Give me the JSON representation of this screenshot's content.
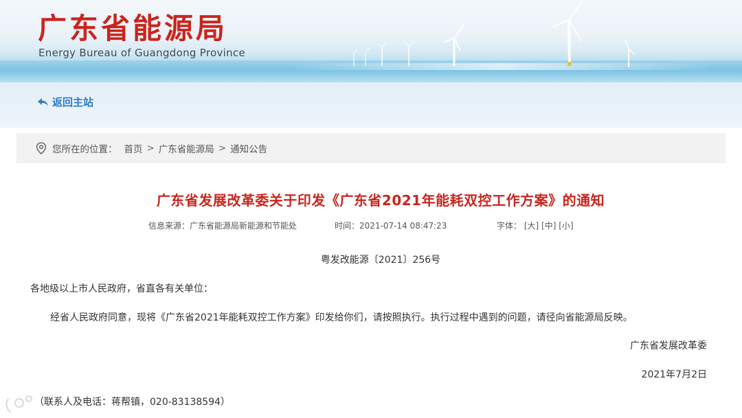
{
  "header": {
    "logo_cn": "广东省能源局",
    "logo_en": "Energy Bureau of Guangdong Province"
  },
  "nav": {
    "return_label": "返回主站",
    "return_icon": "back-arrow-icon"
  },
  "breadcrumb": {
    "icon": "location-pin-icon",
    "label": "您所在的位置：",
    "items": [
      "首页",
      "广东省能源局",
      "通知公告"
    ],
    "separator": ">"
  },
  "article": {
    "title": "广东省发展改革委关于印发《广东省2021年能耗双控工作方案》的通知",
    "source": "信息来源：广东省能源局新能源和节能处",
    "time": "时间：2021-07-14 08:47:23",
    "font_label": "字体：",
    "font_options": [
      "[大]",
      "[中]",
      "[小]"
    ],
    "doc_number": "粤发改能源〔2021〕256号",
    "addressee": "各地级以上市人民政府，省直各有关单位：",
    "body": "经省人民政府同意，现将《广东省2021年能耗双控工作方案》印发给你们，请按照执行。执行过程中遇到的问题，请径向省能源局反映。",
    "signature": "广东省发展改革委",
    "date": "2021年7月2日",
    "contact": "（联系人及电话：蒋帮镇，020-83138594）"
  },
  "colors": {
    "title_red": "#c8261e",
    "link_blue": "#2a7cc8",
    "breadcrumb_bg": "#f2f2f2"
  }
}
